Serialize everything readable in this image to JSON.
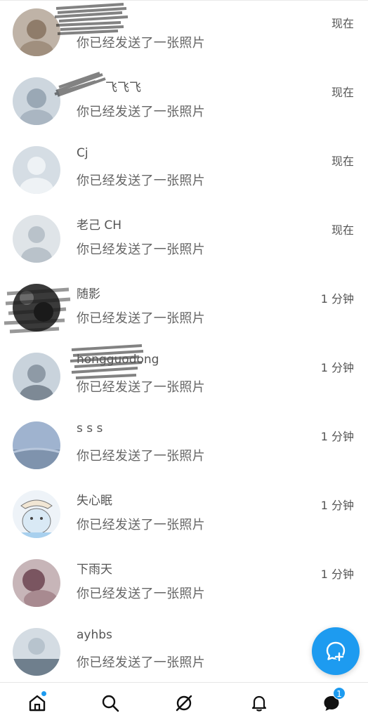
{
  "conversations": [
    {
      "name": "",
      "message": "你已经发送了一张照片",
      "time": "现在",
      "avatar_icon": "user-photo-avatar"
    },
    {
      "name": "飞飞飞",
      "message": "你已经发送了一张照片",
      "time": "现在",
      "avatar_icon": "user-photo-avatar"
    },
    {
      "name": "Cj",
      "message": "你已经发送了一张照片",
      "time": "现在",
      "avatar_icon": "default-person-avatar"
    },
    {
      "name": "老己 CH",
      "message": "你已经发送了一张照片",
      "time": "现在",
      "avatar_icon": "default-person-avatar"
    },
    {
      "name": "随影",
      "message": "你已经发送了一张照片",
      "time": "1 分钟",
      "avatar_icon": "user-photo-avatar"
    },
    {
      "name": "hongguodong",
      "message": "你已经发送了一张照片",
      "time": "1 分钟",
      "avatar_icon": "user-photo-avatar"
    },
    {
      "name": "s s s",
      "message": "你已经发送了一张照片",
      "time": "1 分钟",
      "avatar_icon": "user-photo-avatar"
    },
    {
      "name": "失心眠",
      "message": "你已经发送了一张照片",
      "time": "1 分钟",
      "avatar_icon": "user-photo-avatar"
    },
    {
      "name": "下雨天",
      "message": "你已经发送了一张照片",
      "time": "1 分钟",
      "avatar_icon": "user-photo-avatar"
    },
    {
      "name": "ayhbs",
      "message": "你已经发送了一张照片",
      "time": "",
      "avatar_icon": "user-photo-avatar"
    }
  ],
  "fab": {
    "icon": "new-message-icon"
  },
  "tabbar": {
    "items": [
      {
        "icon": "home-icon",
        "active": true,
        "has_dot": true
      },
      {
        "icon": "search-icon",
        "active": false
      },
      {
        "icon": "spaces-icon",
        "active": false
      },
      {
        "icon": "bell-icon",
        "active": false
      },
      {
        "icon": "messages-icon",
        "active": false,
        "badge": "1"
      }
    ]
  },
  "colors": {
    "accent": "#1d9bf0",
    "text_primary": "#555555",
    "text_secondary": "#666666",
    "divider": "#e6e6e6"
  }
}
